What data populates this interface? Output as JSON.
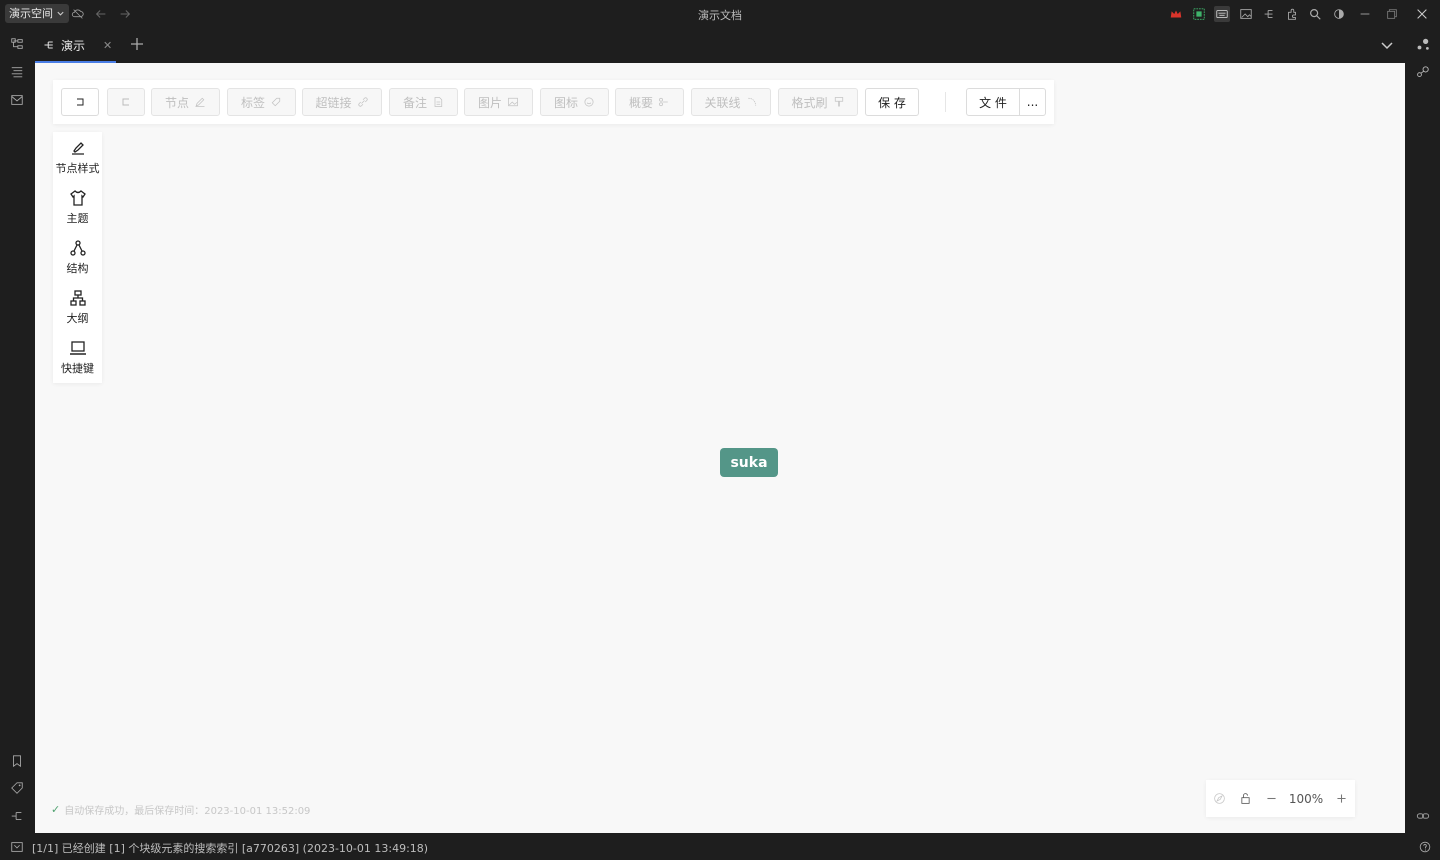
{
  "titlebar": {
    "workspace": "演示空间",
    "title": "演示文档"
  },
  "tabs": [
    {
      "label": "演示"
    }
  ],
  "toolbar": {
    "buttons": [
      {
        "label": "",
        "icon": "back-icon",
        "enabled": true
      },
      {
        "label": "",
        "icon": "forward-icon",
        "enabled": false
      },
      {
        "label": "节点",
        "icon": "pencil-icon",
        "enabled": false
      },
      {
        "label": "标签",
        "icon": "tag-icon",
        "enabled": false
      },
      {
        "label": "超链接",
        "icon": "link-icon",
        "enabled": false
      },
      {
        "label": "备注",
        "icon": "note-icon",
        "enabled": false
      },
      {
        "label": "图片",
        "icon": "image-icon",
        "enabled": false
      },
      {
        "label": "图标",
        "icon": "smiley-icon",
        "enabled": false
      },
      {
        "label": "概要",
        "icon": "summary-icon",
        "enabled": false
      },
      {
        "label": "关联线",
        "icon": "relation-icon",
        "enabled": false
      },
      {
        "label": "格式刷",
        "icon": "format-brush-icon",
        "enabled": false
      },
      {
        "label": "保 存",
        "icon": "",
        "enabled": true
      }
    ],
    "file_label": "文 件",
    "more_label": "..."
  },
  "sidepanel": {
    "items": [
      {
        "label": "节点样式",
        "icon": "highlighter-icon"
      },
      {
        "label": "主题",
        "icon": "shirt-icon"
      },
      {
        "label": "结构",
        "icon": "structure-icon"
      },
      {
        "label": "大纲",
        "icon": "outline-icon"
      },
      {
        "label": "快捷键",
        "icon": "laptop-icon"
      }
    ]
  },
  "canvas": {
    "node_text": "suka",
    "node_color": "#549688",
    "autosave_text": "自动保存成功，最后保存时间：2023-10-01 13:52:09",
    "zoom": "100%"
  },
  "statusbar": {
    "text": "[1/1] 已经创建 [1] 个块级元素的搜索索引 [a770263] (2023-10-01 13:49:18)"
  },
  "colors": {
    "accent": "#4a7ee6",
    "chrome": "#1e1e1e",
    "canvas": "#f8f8f8"
  }
}
